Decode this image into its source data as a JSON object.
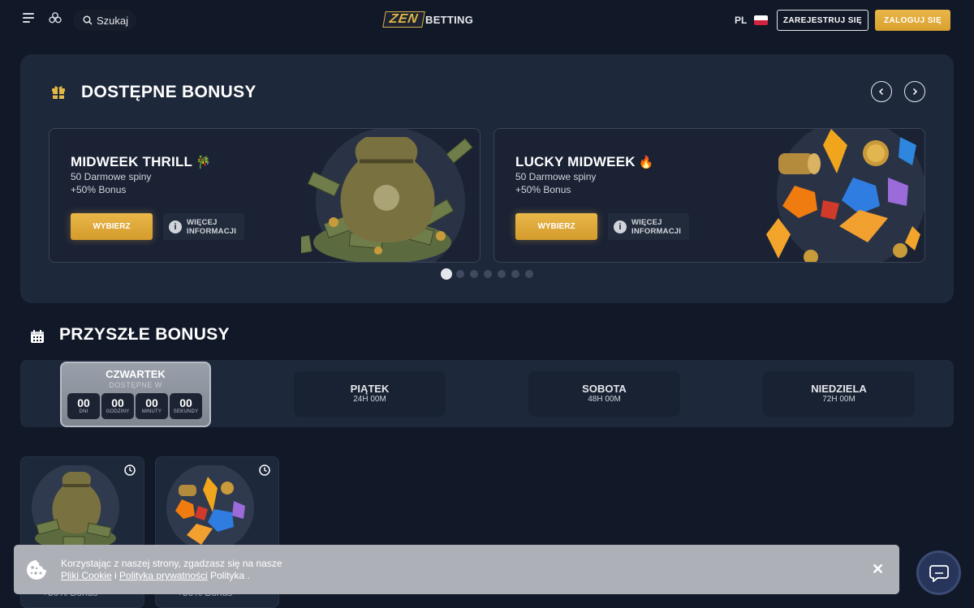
{
  "header": {
    "search_label": "Szukaj",
    "logo_zen": "ZEN",
    "logo_betting": "BETTING",
    "language": "PL",
    "register_label": "ZAREJESTRUJ SIĘ",
    "login_label": "ZALOGUJ SIĘ"
  },
  "available": {
    "title": "DOSTĘPNE BONUSY",
    "cards": [
      {
        "title": "MIDWEEK THRILL",
        "emoji": "🎋",
        "line1": "50 Darmowe spiny",
        "line2": "+50% Bonus",
        "choose_label": "WYBIERZ",
        "info_label_1": "WIĘCEJ",
        "info_label_2": "INFORMACJI"
      },
      {
        "title": "LUCKY MIDWEEK",
        "emoji": "🔥",
        "line1": "50 Darmowe spiny",
        "line2": "+50% Bonus",
        "choose_label": "WYBIERZ",
        "info_label_1": "WIĘCEJ",
        "info_label_2": "INFORMACJI"
      }
    ],
    "carousel_pages": 7,
    "carousel_active": 1
  },
  "upcoming": {
    "title": "PRZYSZŁE BONUSY",
    "active_day": {
      "name": "CZWARTEK",
      "sub": "DOSTĘPNE W",
      "countdown": [
        {
          "value": "00",
          "label": "DNI"
        },
        {
          "value": "00",
          "label": "GODZINY"
        },
        {
          "value": "00",
          "label": "MINUTY"
        },
        {
          "value": "00",
          "label": "SEKUNDY"
        }
      ]
    },
    "days": [
      {
        "name": "PIĄTEK",
        "time": "24H 00M"
      },
      {
        "name": "SOBOTA",
        "time": "48H 00M"
      },
      {
        "name": "NIEDZIELA",
        "time": "72H 00M"
      }
    ]
  },
  "tiles": [
    {
      "partial_text": "+50% Bonus"
    },
    {
      "partial_text": "+50% Bonus"
    }
  ],
  "cookie": {
    "line1": "Korzystając z naszej strony, zgadzasz się na nasze",
    "link_cookie": "Pliki Cookie",
    "connector": " i ",
    "link_privacy": "Polityka prywatności",
    "tail": " Polityka ."
  },
  "colors": {
    "background": "#111827",
    "panel": "#1e283b",
    "accent_gold": "#e2b846",
    "flag_red": "#d4213d"
  },
  "icons": {
    "menu": "hamburger-icon",
    "apps": "clover-icon",
    "search": "search-icon",
    "gift": "gift-icon",
    "calendar": "calendar-icon",
    "info": "info-icon",
    "clock": "clock-icon",
    "cookie": "cookie-icon",
    "close": "close-icon",
    "chat": "chat-icon"
  }
}
